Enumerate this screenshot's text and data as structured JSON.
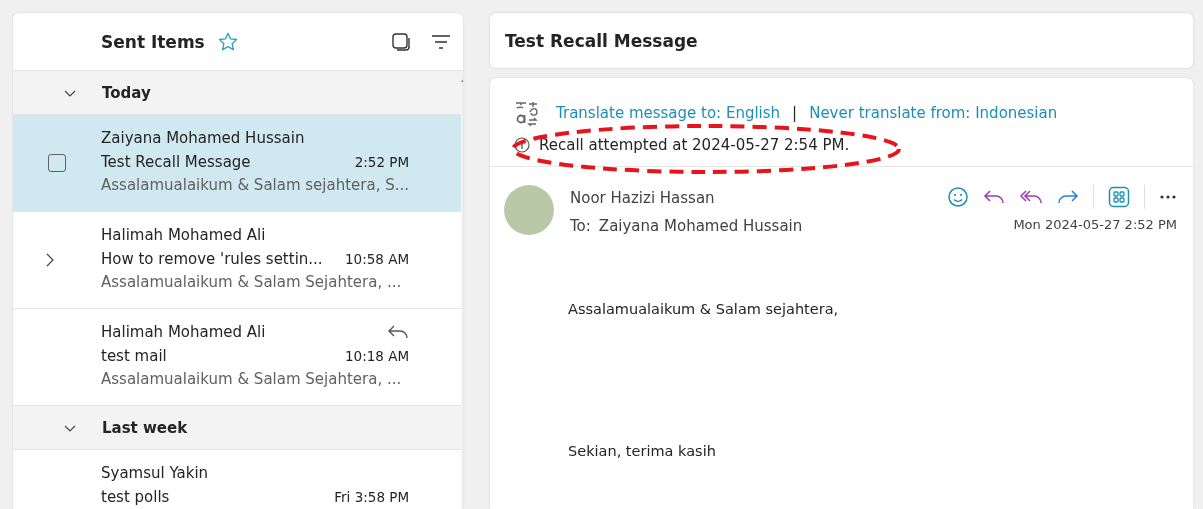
{
  "folder": {
    "title": "Sent Items",
    "favorite": false
  },
  "groups": [
    {
      "label": "Today",
      "expanded": true,
      "emails": [
        {
          "sender": "Zaiyana Mohamed Hussain",
          "subject": "Test Recall Message",
          "time": "2:52 PM",
          "preview": "Assalamualaikum & Salam sejahtera, S...",
          "selected": true,
          "conversation": false,
          "replied": false
        },
        {
          "sender": "Halimah Mohamed Ali",
          "subject": "How to remove 'rules settin...",
          "time": "10:58 AM",
          "preview": "Assalamualaikum & Salam Sejahtera, ...",
          "selected": false,
          "conversation": true,
          "replied": false
        },
        {
          "sender": "Halimah Mohamed Ali",
          "subject": "test mail",
          "time": "10:18 AM",
          "preview": "Assalamualaikum & Salam Sejahtera, ...",
          "selected": false,
          "conversation": false,
          "replied": true
        }
      ]
    },
    {
      "label": "Last week",
      "expanded": true,
      "emails": [
        {
          "sender": "Syamsul Yakin",
          "subject": "test polls",
          "time": "Fri 3:58 PM",
          "selected": false,
          "conversation": false,
          "replied": false
        }
      ]
    }
  ],
  "reading": {
    "subject": "Test Recall Message",
    "translate_link": "Translate message to: English",
    "separator": "|",
    "never_translate_link": "Never translate from: Indonesian",
    "recall_notice": "Recall attempted at 2024-05-27 2:54 PM.",
    "from": "Noor Hazizi Hassan",
    "to_label": "To:",
    "to": "Zaiyana Mohamed Hussain",
    "date": "Mon 2024-05-27 2:52 PM",
    "body": [
      "Assalamualaikum & Salam sejahtera,",
      "Sekian, terima kasih"
    ]
  }
}
